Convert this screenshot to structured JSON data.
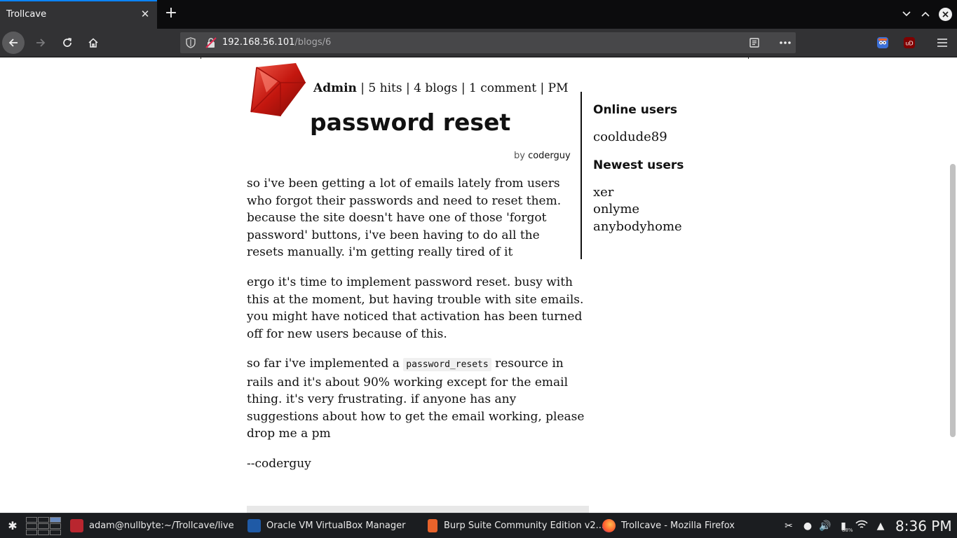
{
  "browser": {
    "tab_title": "Trollcave",
    "url_host": "192.168.56.101",
    "url_path": "/blogs/6"
  },
  "post": {
    "author_meta_name": "Admin",
    "author_meta_stats": " | 5 hits | 4 blogs | 1 comment | PM",
    "title": "password reset",
    "byline_prefix": "by ",
    "byline_author": "coderguy",
    "paragraphs": [
      "so i've been getting a lot of emails lately from users who forgot their passwords and need to reset them. because the site doesn't have one of those 'forgot password' buttons, i've been having to do all the resets manually. i'm getting really tired of it",
      "ergo it's time to implement password reset. busy with this at the moment, but having trouble with site emails. you might have noticed that activation has been turned off for new users because of this."
    ],
    "p3_before_code": "so far i've implemented a ",
    "p3_code": "password_resets",
    "p3_after_code": " resource in rails and it's about 90% working except for the email thing. it's very frustrating. if anyone has any suggestions about how to get the email working, please drop me a pm",
    "signature": "--coderguy"
  },
  "sidebar": {
    "online_heading": "Online users",
    "online_users": [
      "cooldude89"
    ],
    "newest_heading": "Newest users",
    "newest_users": [
      "xer",
      "onlyme",
      "anybodyhome"
    ]
  },
  "taskbar": {
    "tasks": [
      {
        "label": "adam@nullbyte:~/Trollcave/live",
        "icon": "terminal-icon"
      },
      {
        "label": "Oracle VM VirtualBox Manager",
        "icon": "virtualbox-icon"
      },
      {
        "label": "Burp Suite Community Edition v2...",
        "icon": "burp-icon"
      },
      {
        "label": "Trollcave - Mozilla Firefox",
        "icon": "firefox-icon"
      }
    ],
    "battery": "88%",
    "clock": "8:36 PM"
  },
  "colors": {
    "tab_accent": "#0a84ff",
    "chrome_dark": "#0c0c0d",
    "toolbar": "#323234",
    "taskbar": "#1b1d20"
  }
}
